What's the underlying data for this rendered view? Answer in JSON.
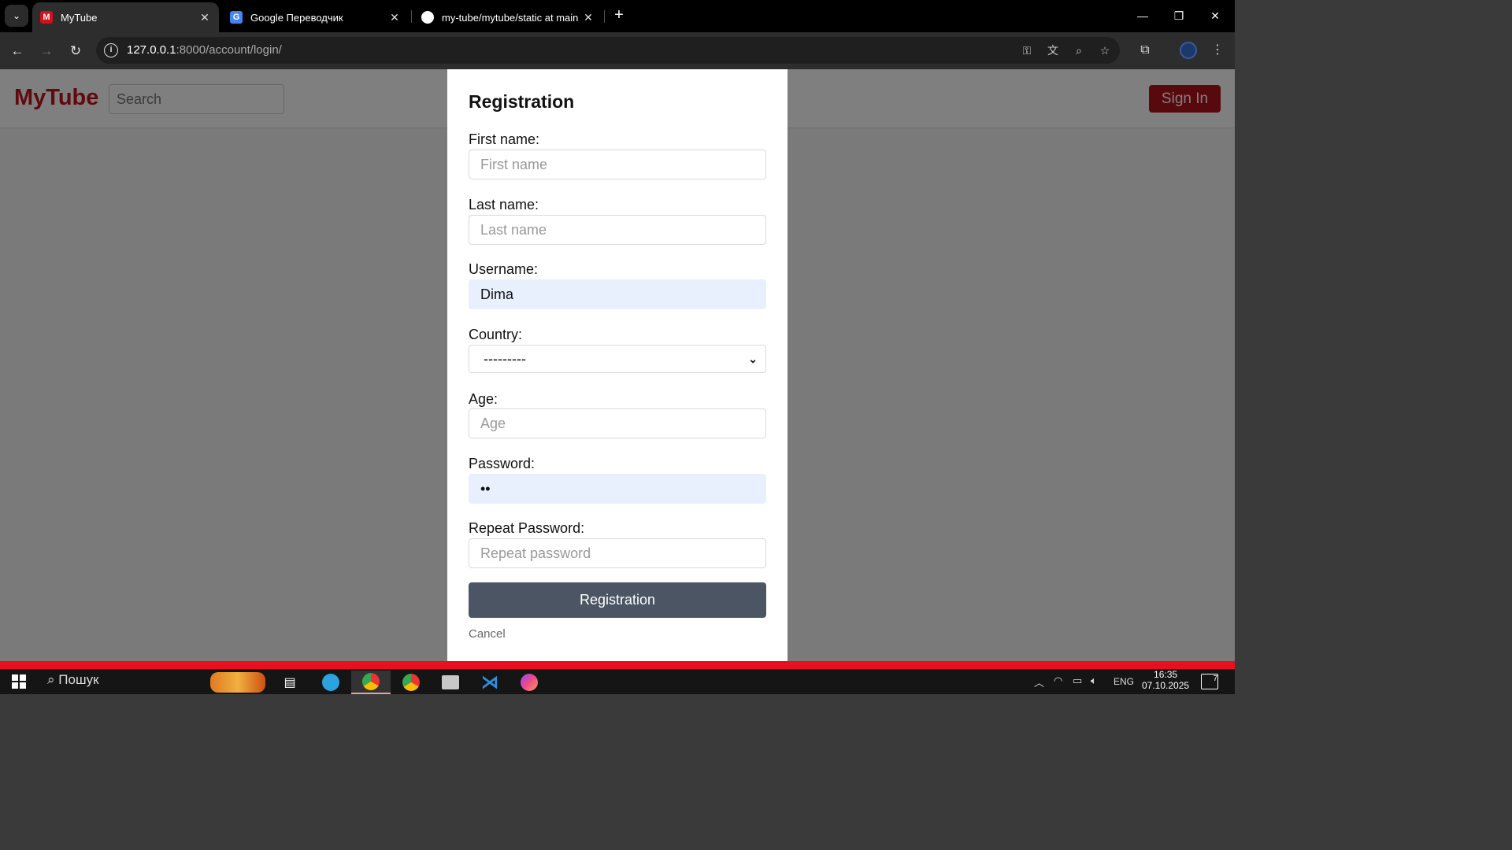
{
  "browser": {
    "tabs": [
      {
        "title": "MyTube",
        "favicon": "M"
      },
      {
        "title": "Google Переводчик",
        "favicon": "G"
      },
      {
        "title": "my-tube/mytube/static at main",
        "favicon": "github-icon"
      }
    ],
    "url_host": "127.0.0.1",
    "url_rest": ":8000/account/login/"
  },
  "site": {
    "logo": "MyTube",
    "search_placeholder": "Search",
    "signin_label": "Sign In",
    "brand_color": "#c0151c"
  },
  "modal": {
    "title": "Registration",
    "fields": {
      "first_name": {
        "label": "First name:",
        "placeholder": "First name"
      },
      "last_name": {
        "label": "Last name:",
        "placeholder": "Last name"
      },
      "username": {
        "label": "Username:",
        "value": "Dima"
      },
      "country": {
        "label": "Country:",
        "value": "---------"
      },
      "age": {
        "label": "Age:",
        "placeholder": "Age"
      },
      "password": {
        "label": "Password:",
        "value": "••"
      },
      "repeat_password": {
        "label": "Repeat Password:",
        "placeholder": "Repeat password"
      }
    },
    "submit_label": "Registration",
    "cancel_label": "Cancel"
  },
  "taskbar": {
    "search_label": "Пошук",
    "language": "ENG",
    "time": "16:35",
    "date": "07.10.2025",
    "notifications": "7"
  }
}
